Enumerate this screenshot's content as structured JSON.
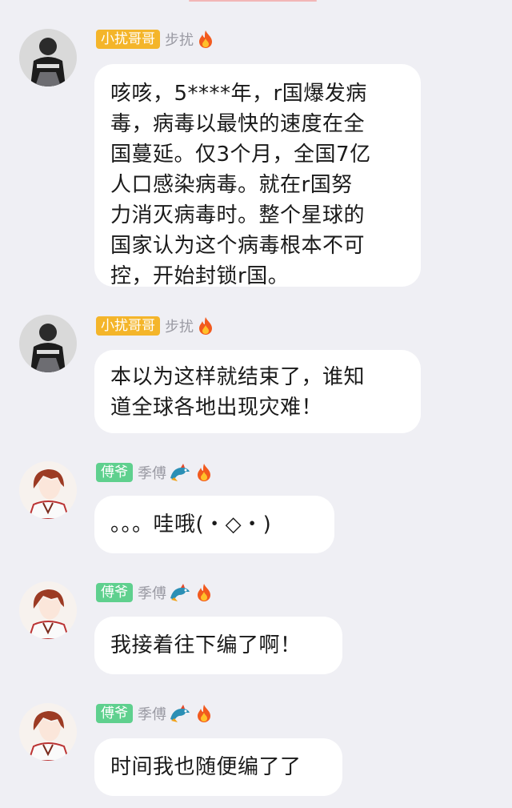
{
  "messages": [
    {
      "tag": "小扰哥哥",
      "nickname": "步扰",
      "lines": [
        "咳咳，5****年，r国爆发病",
        "毒，病毒以最快的速度在全",
        "国蔓延。仅3个月，全国7亿",
        "人口感染病毒。就在r国努",
        "力消灭病毒时。整个星球的",
        "国家认为这个病毒根本不可",
        "控，开始封锁r国。"
      ]
    },
    {
      "tag": "小扰哥哥",
      "nickname": "步扰",
      "lines": [
        "本以为这样就结束了，谁知",
        "道全球各地出现灾难！"
      ]
    },
    {
      "tag": "傅爷",
      "nickname": "季傅",
      "lines": [
        "。。。哇哦(・◇・)"
      ]
    },
    {
      "tag": "傅爷",
      "nickname": "季傅",
      "lines": [
        "我接着往下编了啊！"
      ]
    },
    {
      "tag": "傅爷",
      "nickname": "季傅",
      "lines": [
        "时间我也随便编了了"
      ]
    }
  ],
  "icons": {
    "fire": "fire-icon",
    "dragon": "dragon-badge-icon"
  },
  "colors": {
    "gold_tag": "#f4b52a",
    "green_tag": "#5fd08e",
    "background": "#efeff4",
    "bubble": "#ffffff"
  }
}
